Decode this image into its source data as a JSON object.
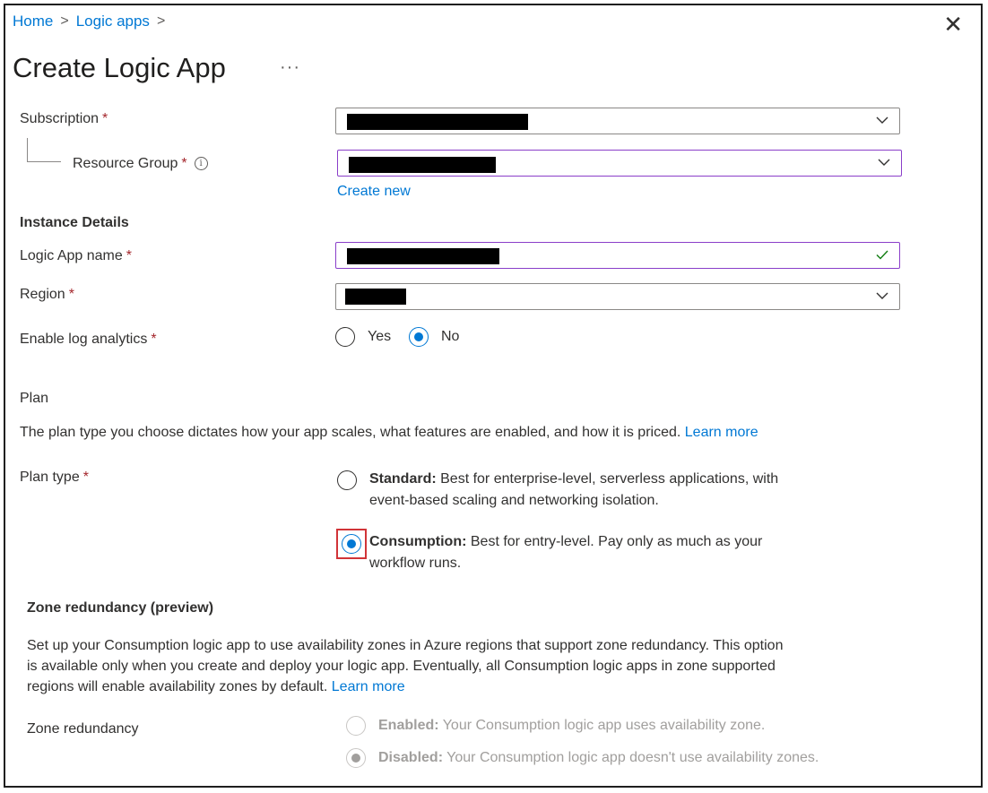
{
  "breadcrumb": {
    "home": "Home",
    "logic_apps": "Logic apps",
    "sep": ">"
  },
  "close_glyph": "✕",
  "title": "Create Logic App",
  "more_glyph": "···",
  "subscription": {
    "label": "Subscription"
  },
  "resource_group": {
    "label": "Resource Group",
    "create_new": "Create new"
  },
  "instance_details": "Instance Details",
  "logic_app_name": {
    "label": "Logic App name"
  },
  "region": {
    "label": "Region"
  },
  "log_analytics": {
    "label": "Enable log analytics",
    "yes": "Yes",
    "no": "No",
    "selected": "No"
  },
  "required_mark": "*",
  "info_glyph": "i",
  "plan": {
    "heading": "Plan",
    "description": "The plan type you choose dictates how your app scales, what features are enabled, and how it is priced.",
    "learn_more": "Learn more",
    "type_label": "Plan type",
    "standard_title": "Standard:",
    "standard_desc_1": "Best for enterprise-level, serverless applications, with",
    "standard_desc_2": "event-based scaling and networking isolation.",
    "consumption_title": "Consumption:",
    "consumption_desc_1": "Best for entry-level. Pay only as much as your",
    "consumption_desc_2": "workflow runs.",
    "selected": "Consumption"
  },
  "zone": {
    "heading": "Zone redundancy (preview)",
    "line1": "Set up your Consumption logic app to use availability zones in Azure regions that support zone redundancy. This option",
    "line2": "is available only when you create and deploy your logic app. Eventually, all Consumption logic apps in zone supported",
    "line3": "regions will enable availability zones by default.",
    "learn_more": "Learn more",
    "label": "Zone redundancy",
    "enabled_title": "Enabled:",
    "enabled_desc": "Your Consumption logic app uses availability zone.",
    "disabled_title": "Disabled:",
    "disabled_desc": "Your Consumption logic app doesn't use availability zones.",
    "selected": "Disabled"
  },
  "colors": {
    "accent": "#0078d4",
    "required": "#a4262c",
    "focus_border": "#8a3ec9",
    "valid": "#107c10",
    "highlight": "#d13438"
  }
}
